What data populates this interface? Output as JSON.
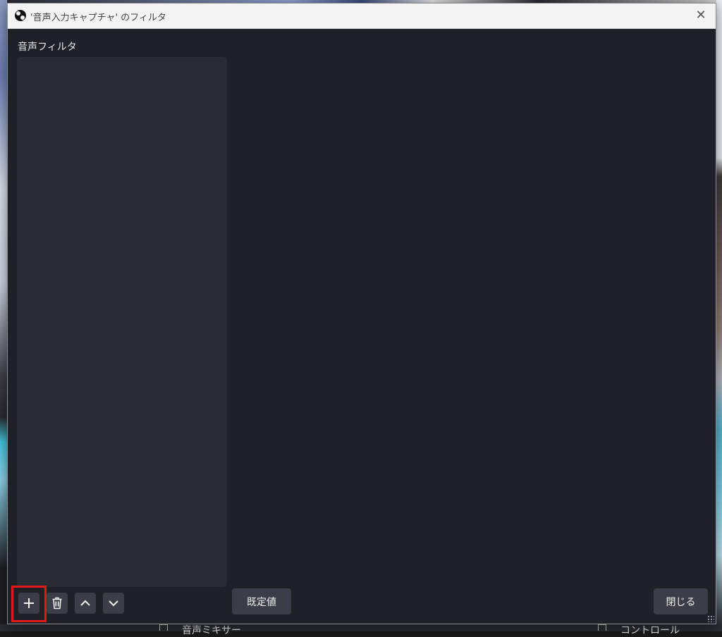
{
  "window": {
    "title": "'音声入力キャプチャ' のフィルタ",
    "close_symbol": "✕"
  },
  "filters": {
    "section_label": "音声フィルタ",
    "items": []
  },
  "toolbar": {
    "add_icon": "plus-icon",
    "remove_icon": "trash-icon",
    "move_up_icon": "chevron-up-icon",
    "move_down_icon": "chevron-down-icon",
    "defaults_label": "既定値",
    "close_label": "閉じる"
  },
  "background": {
    "audio_mixer_title": "音声ミキサー",
    "controls_title": "コントロール"
  },
  "colors": {
    "dialog_bg": "#1f2129",
    "list_bg": "#2a2c35",
    "button_bg": "#3b3e49",
    "highlight": "#e11919"
  }
}
